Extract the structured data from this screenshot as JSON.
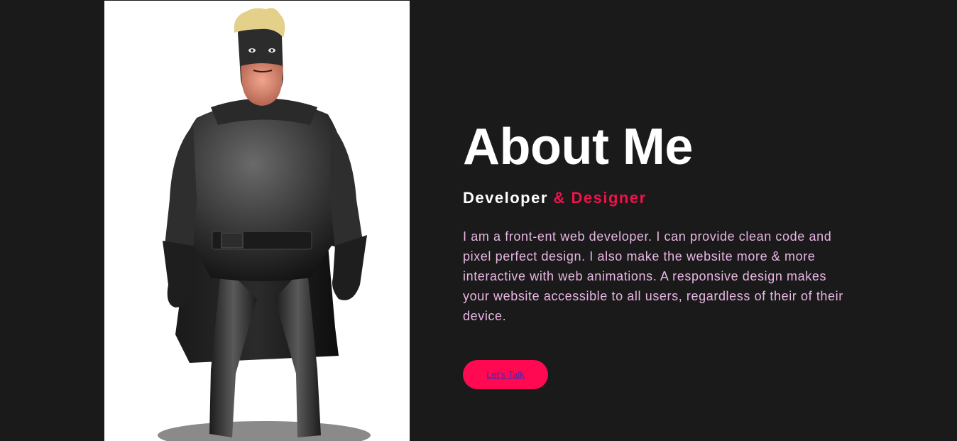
{
  "about": {
    "heading": "About Me",
    "subheading_primary": "Developer ",
    "subheading_accent": "& Designer",
    "bio": "I am a front-ent web developer. I can provide clean code and pixel perfect design. I also make the website more & more interactive with web animations. A responsive design makes your website accessible to all users, regardless of their of their device.",
    "cta_label": "Let's Talk"
  },
  "image": {
    "subject": "3D masked superhero character",
    "icon": "character-illustration"
  },
  "colors": {
    "page_background": "#1a1a1a",
    "image_panel_background": "#ffffff",
    "heading": "#ffffff",
    "accent": "#f0124b",
    "bio_text": "#e8b6e3",
    "button_background": "#ff0a52",
    "button_text": "#3b2bb8"
  }
}
